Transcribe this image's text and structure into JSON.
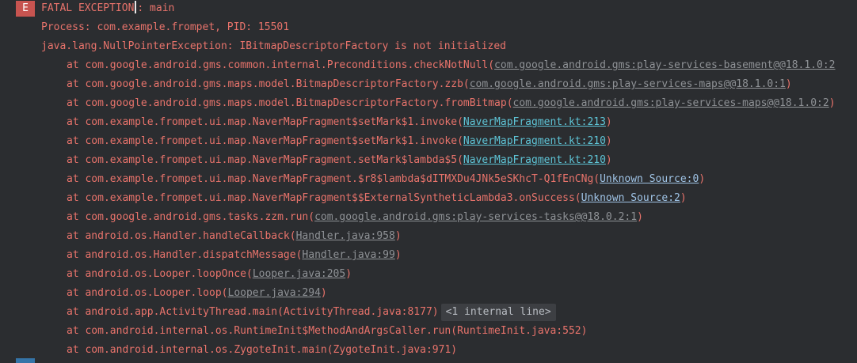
{
  "header": {
    "level_badge": "E",
    "fatal_before_caret": "FATAL EXCEPTION",
    "fatal_after_caret": ": main"
  },
  "process_line": "Process: com.example.frompet, PID: 15501",
  "exception_line": "java.lang.NullPointerException: IBitmapDescriptorFactory is not initialized",
  "frames": [
    {
      "text": "at com.google.android.gms.common.internal.Preconditions.checkNotNull(",
      "link": "com.google.android.gms:play-services-basement@@18.1.0:2",
      "close": ""
    },
    {
      "text": "at com.google.android.gms.maps.model.BitmapDescriptorFactory.zzb(",
      "link": "com.google.android.gms:play-services-maps@@18.1.0:1",
      "close": ")"
    },
    {
      "text": "at com.google.android.gms.maps.model.BitmapDescriptorFactory.fromBitmap(",
      "link": "com.google.android.gms:play-services-maps@@18.1.0:2",
      "close": ")"
    },
    {
      "text": "at com.example.frompet.ui.map.NaverMapFragment$setMark$1.invoke(",
      "link": "NaverMapFragment.kt:213",
      "close": ")"
    },
    {
      "text": "at com.example.frompet.ui.map.NaverMapFragment$setMark$1.invoke(",
      "link": "NaverMapFragment.kt:210",
      "close": ")"
    },
    {
      "text": "at com.example.frompet.ui.map.NaverMapFragment.setMark$lambda$5(",
      "link": "NaverMapFragment.kt:210",
      "close": ")"
    },
    {
      "text": "at com.example.frompet.ui.map.NaverMapFragment.$r8$lambda$dITMXDu4JNk5eSKhcT-Q1fEnCNg(",
      "link": "Unknown Source:0",
      "close": ")"
    },
    {
      "text": "at com.example.frompet.ui.map.NaverMapFragment$$ExternalSyntheticLambda3.onSuccess(",
      "link": "Unknown Source:2",
      "close": ")"
    },
    {
      "text": "at com.google.android.gms.tasks.zzm.run(",
      "link": "com.google.android.gms:play-services-tasks@@18.0.2:1",
      "close": ")"
    },
    {
      "text": "at android.os.Handler.handleCallback(",
      "link": "Handler.java:958",
      "close": ")"
    },
    {
      "text": "at android.os.Handler.dispatchMessage(",
      "link": "Handler.java:99",
      "close": ")"
    },
    {
      "text": "at android.os.Looper.loopOnce(",
      "link": "Looper.java:205",
      "close": ")"
    },
    {
      "text": "at android.os.Looper.loop(",
      "link": "Looper.java:294",
      "close": ")"
    },
    {
      "text": "at android.app.ActivityThread.main(ActivityThread.java:8177)",
      "internal": "<1 internal line>"
    },
    {
      "text": "at com.android.internal.os.RuntimeInit$MethodAndArgsCaller.run(RuntimeInit.java:552)"
    },
    {
      "text": "at com.android.internal.os.ZygoteInit.main(ZygoteInit.java:971)"
    }
  ]
}
